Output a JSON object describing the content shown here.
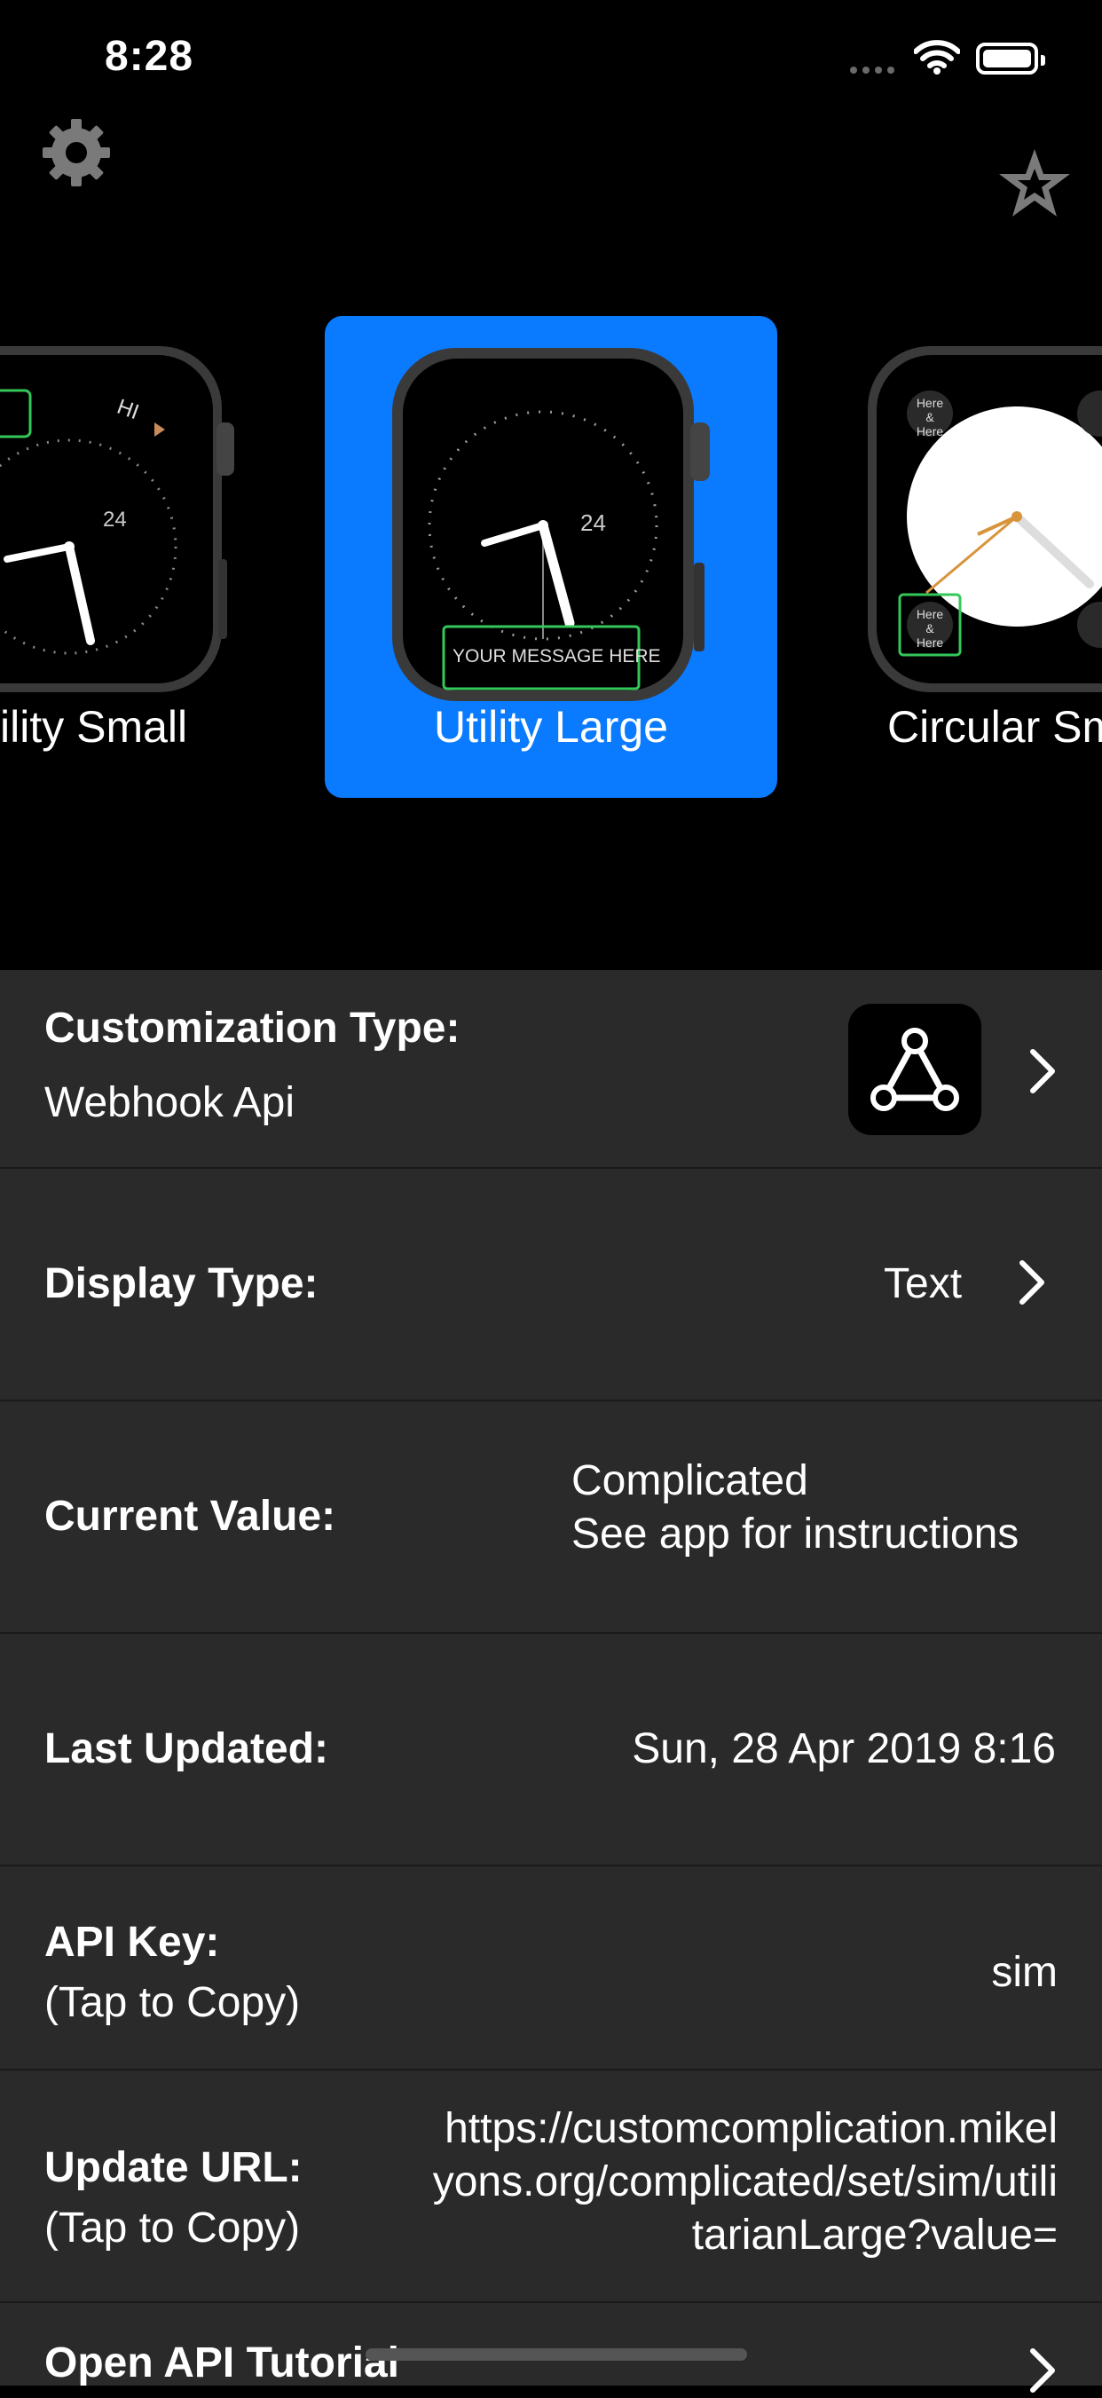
{
  "status_bar": {
    "time": "8:28"
  },
  "top": {
    "settings_icon": "gear-icon",
    "favorite_icon": "star-icon"
  },
  "carousel": {
    "items": [
      {
        "label": "ility Small",
        "selected": false,
        "face_text": "HI",
        "face_number": "24"
      },
      {
        "label": "Utility Large",
        "selected": true,
        "face_number": "24",
        "message": "YOUR MESSAGE HERE"
      },
      {
        "label": "Circular Sm",
        "selected": false,
        "corner_text": "Here & Here"
      }
    ]
  },
  "rows": {
    "customization": {
      "label": "Customization Type:",
      "value": "Webhook Api",
      "icon": "webhook-icon"
    },
    "display": {
      "label": "Display Type:",
      "value": "Text"
    },
    "current": {
      "label": "Current Value:",
      "value_line1": "Complicated",
      "value_line2": "See app for instructions"
    },
    "updated": {
      "label": "Last Updated:",
      "value": "Sun, 28 Apr 2019 8:16"
    },
    "api_key": {
      "label": "API Key:",
      "hint": "(Tap to Copy)",
      "value": "sim"
    },
    "update_url": {
      "label": "Update URL:",
      "hint": "(Tap to Copy)",
      "value_line1": "https://customcomplication.mikel",
      "value_line2": "yons.org/complicated/set/sim/utili",
      "value_line3": "tarianLarge?value="
    },
    "tutorial": {
      "label": "Open API Tutorial"
    }
  },
  "colors": {
    "accent": "#0a7bff",
    "list_bg": "#2a2a2a",
    "complication_border": "#34c759"
  }
}
